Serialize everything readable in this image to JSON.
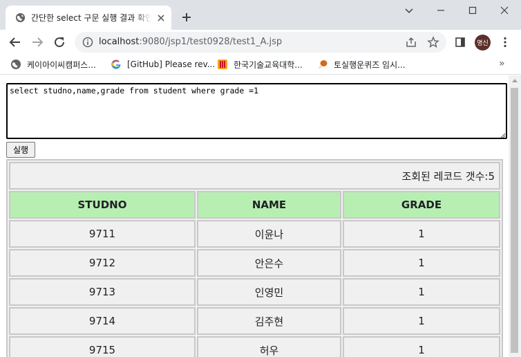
{
  "browser": {
    "tab": {
      "title": "간단한 select 구문 실행 결과 확인",
      "favicon": "globe-icon"
    },
    "window_controls": [
      "tab-search-icon",
      "minimize-icon",
      "maximize-icon",
      "close-icon"
    ],
    "url_host": "localhost",
    "url_path": ":9080/jsp1/test0928/test1_A.jsp",
    "profile_label": "명신",
    "profile_color": "#5b2f2a",
    "bookmarks": [
      {
        "label": "케이아이씨캠퍼스...",
        "icon": "globe-icon"
      },
      {
        "label": "[GitHub] Please rev...",
        "icon": "google-icon"
      },
      {
        "label": "한국기술교육대학...",
        "icon": "koreatech-icon"
      },
      {
        "label": "토실행운퀴즈 임시...",
        "icon": "drumstick-icon"
      }
    ],
    "bookmarks_more": "»"
  },
  "page": {
    "query": "select studno,name,grade from student where grade =1",
    "run_label": "실행",
    "record_count_label": "조회된 레코드 갯수:5",
    "columns": [
      "STUDNO",
      "NAME",
      "GRADE"
    ],
    "rows": [
      [
        "9711",
        "이윤나",
        "1"
      ],
      [
        "9712",
        "안은수",
        "1"
      ],
      [
        "9713",
        "인영민",
        "1"
      ],
      [
        "9714",
        "김주현",
        "1"
      ],
      [
        "9715",
        "허우",
        "1"
      ]
    ],
    "header_color": "#b7efb3",
    "cell_color": "#f0f0f0"
  }
}
